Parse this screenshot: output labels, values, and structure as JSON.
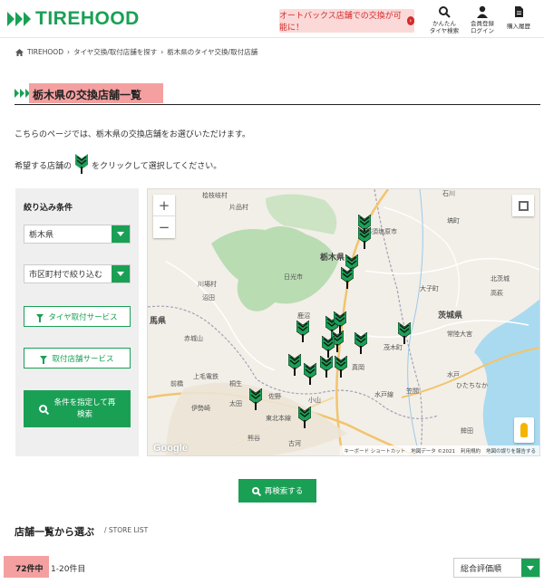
{
  "header": {
    "logo": "TIREHOOD",
    "notice": "オートバックス店舗での交換が可能に！",
    "nav": [
      {
        "icon": "search-icon",
        "label1": "かんたん",
        "label2": "タイヤ検索"
      },
      {
        "icon": "user-icon",
        "label1": "会員登録",
        "label2": "ログイン"
      },
      {
        "icon": "document-icon",
        "label1": "購入履歴",
        "label2": ""
      }
    ]
  },
  "breadcrumb": {
    "home": "TIREHOOD",
    "item1": "タイヤ交換/取付店舗を探す",
    "item2": "栃木県のタイヤ交換/取付店舗",
    "separator": "›"
  },
  "page": {
    "title": "栃木県の交換店舗一覧",
    "intro1": "こちらのページでは、栃木県の交換店舗をお選びいただけます。",
    "intro2_before": "希望する店舗の",
    "intro2_after": "をクリックして選択してください。"
  },
  "filter": {
    "title": "絞り込み条件",
    "prefecture": "栃木県",
    "city_placeholder": "市区町村で絞り込む",
    "tire_service": "タイヤ取付サービス",
    "store_service": "取付店舗サービス",
    "search_line1": "条件を指定して再",
    "search_line2": "検索"
  },
  "map": {
    "zoom_in": "+",
    "zoom_out": "−",
    "google": "Google",
    "attribution": [
      "キーボード ショートカット",
      "地図データ ©2021",
      "利用規約",
      "地図の誤りを報告する"
    ],
    "labels": [
      {
        "text": "栃木県",
        "big": true
      },
      {
        "text": "茨城県",
        "big": true
      },
      {
        "text": "馬県",
        "big": true
      },
      {
        "text": "日光市",
        "big": false
      },
      {
        "text": "那須塩原市",
        "big": false
      },
      {
        "text": "赤城山",
        "big": false
      },
      {
        "text": "佐野",
        "big": false
      },
      {
        "text": "小山",
        "big": false
      },
      {
        "text": "太田",
        "big": false
      },
      {
        "text": "前橋",
        "big": false
      },
      {
        "text": "伊勢崎",
        "big": false
      },
      {
        "text": "桐生",
        "big": false
      },
      {
        "text": "古河",
        "big": false
      },
      {
        "text": "笠間",
        "big": false
      },
      {
        "text": "水戸",
        "big": false
      },
      {
        "text": "ひたちなか",
        "big": false
      },
      {
        "text": "上毛電鉄",
        "big": false
      },
      {
        "text": "真岡",
        "big": false
      },
      {
        "text": "茂木町",
        "big": false
      },
      {
        "text": "大子町",
        "big": false
      },
      {
        "text": "常陸大宮",
        "big": false
      },
      {
        "text": "石川",
        "big": false
      },
      {
        "text": "鹿沼",
        "big": false
      },
      {
        "text": "片品村",
        "big": false
      },
      {
        "text": "沼田",
        "big": false
      },
      {
        "text": "川場村",
        "big": false
      },
      {
        "text": "水戸線",
        "big": false
      },
      {
        "text": "北茨城",
        "big": false
      },
      {
        "text": "高萩",
        "big": false
      },
      {
        "text": "桧枝岐村",
        "big": false
      },
      {
        "text": "熊谷",
        "big": false
      },
      {
        "text": "東北本線",
        "big": false
      },
      {
        "text": "鉾田",
        "big": false
      },
      {
        "text": "塙町",
        "big": false
      }
    ]
  },
  "research_button": "再検索する",
  "list": {
    "title": "店舗一覧から選ぶ",
    "subtitle": "/ STORE LIST",
    "count": "72件中",
    "range": "1-20件目",
    "sort": "総合評価順"
  },
  "colors": {
    "brand_green": "#1aa055",
    "highlight": "#f4a0a0",
    "notice_bg": "#fbd9d9",
    "notice_text": "#d42a2a"
  }
}
